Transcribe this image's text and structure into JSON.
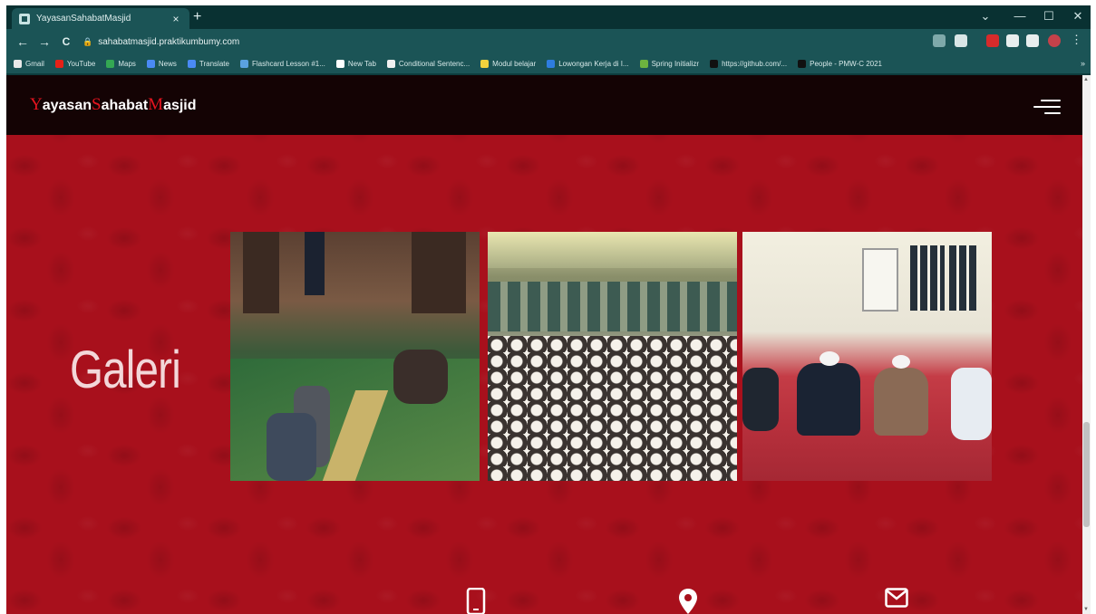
{
  "browser": {
    "tab_title": "YayasanSahabatMasjid",
    "tab_close": "×",
    "new_tab": "+",
    "window_buttons": [
      "⌄",
      "—",
      "☐",
      "✕"
    ],
    "url": "sahabatmasjid.praktikumbumy.com",
    "nav": {
      "back": "←",
      "forward": "→",
      "reload": "C"
    },
    "bookmarks": [
      {
        "label": "Gmail",
        "color": "#e9e9e9"
      },
      {
        "label": "YouTube",
        "color": "#e62117"
      },
      {
        "label": "Maps",
        "color": "#34a853"
      },
      {
        "label": "News",
        "color": "#4a8af4"
      },
      {
        "label": "Translate",
        "color": "#4a8af4"
      },
      {
        "label": "Flashcard Lesson #1...",
        "color": "#5aa2e0"
      },
      {
        "label": "New Tab",
        "color": "#ffffff"
      },
      {
        "label": "Conditional Sentenc...",
        "color": "#f0f0f0"
      },
      {
        "label": "Modul belajar",
        "color": "#f2d23d"
      },
      {
        "label": "Lowongan Kerja di I...",
        "color": "#2e7de0"
      },
      {
        "label": "Spring Initializr",
        "color": "#6db33f"
      },
      {
        "label": "https://github.com/...",
        "color": "#111111"
      },
      {
        "label": "People - PMW-C 2021",
        "color": "#111111"
      }
    ],
    "bookmarks_more": "»",
    "extension_colors": [
      "#7fa9aa",
      "#d9e6e6",
      "#d62b2b",
      "#e8eeee",
      "#e8eeee",
      "#c4414a"
    ]
  },
  "site": {
    "brand": {
      "y": "Y",
      "ayasan": "ayasan",
      "s": "S",
      "ahabat": "ahabat",
      "m": "M",
      "asjid": "asjid"
    },
    "gallery_title": "Galeri",
    "colors": {
      "accent": "#e4141f",
      "background": "#a8101c",
      "navbar": "#140304"
    }
  }
}
